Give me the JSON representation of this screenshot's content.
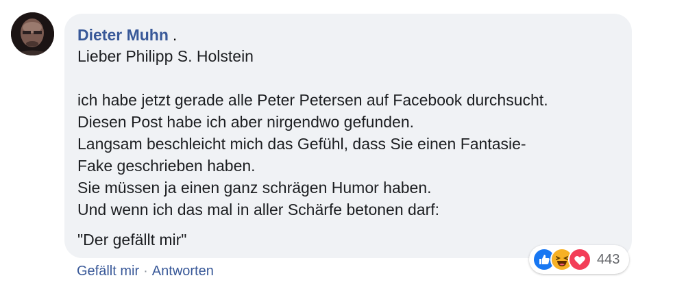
{
  "comment": {
    "author": "Dieter Muhn",
    "author_suffix": ".",
    "greeting": "Lieber Philipp S. Holstein",
    "body_lines": [
      "ich habe jetzt gerade alle Peter Petersen auf Facebook durchsucht.",
      "Diesen Post habe ich aber nirgendwo gefunden.",
      "Langsam beschleicht mich das Gefühl, dass Sie einen Fantasie-",
      "Fake geschrieben haben.",
      "Sie müssen ja einen ganz schrägen Humor haben.",
      "Und wenn ich das mal in aller Schärfe betonen darf:"
    ],
    "quote": "\"Der gefällt mir\""
  },
  "actions": {
    "like_label": "Gefällt mir",
    "separator": "·",
    "reply_label": "Antworten"
  },
  "reactions": {
    "icons": [
      "like-icon",
      "haha-icon",
      "love-icon"
    ],
    "count": "443"
  },
  "colors": {
    "author": "#385898",
    "bubble": "#f0f2f5",
    "like": "#1877f2",
    "haha": "#f7b125",
    "love": "#f33e58"
  }
}
